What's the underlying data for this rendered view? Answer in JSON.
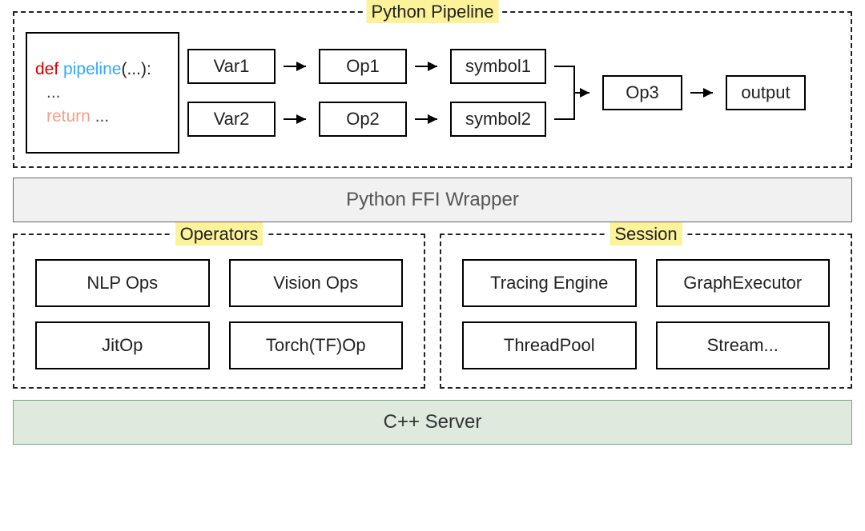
{
  "pipeline": {
    "title": "Python Pipeline",
    "code": {
      "def": "def",
      "name": "pipeline",
      "params": "(...):",
      "ellipsis": "...",
      "return_kw": "return",
      "return_rest": " ..."
    },
    "row1": [
      "Var1",
      "Op1",
      "symbol1"
    ],
    "row2": [
      "Var2",
      "Op2",
      "symbol2"
    ],
    "tail": [
      "Op3",
      "output"
    ]
  },
  "ffi": {
    "label": "Python FFI Wrapper"
  },
  "operators": {
    "title": "Operators",
    "items": [
      "NLP Ops",
      "Vision Ops",
      "JitOp",
      "Torch(TF)Op"
    ]
  },
  "session": {
    "title": "Session",
    "items": [
      "Tracing Engine",
      "GraphExecutor",
      "ThreadPool",
      "Stream..."
    ]
  },
  "server": {
    "label": "C++ Server"
  }
}
